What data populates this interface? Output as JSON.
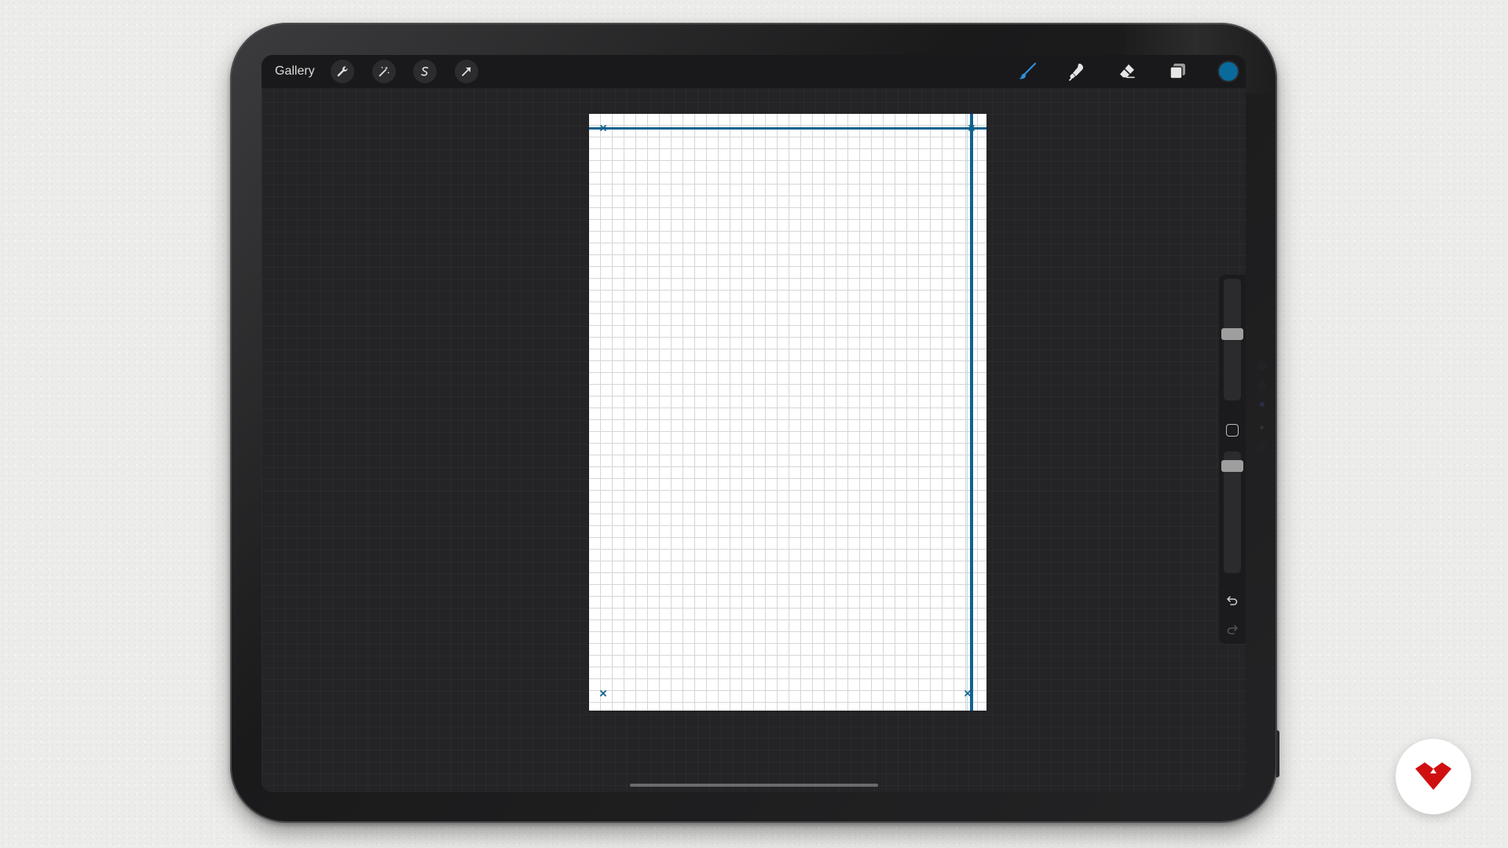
{
  "toolbar": {
    "gallery_label": "Gallery",
    "left_tools": [
      "wrench-icon",
      "magic-wand-icon",
      "selection-icon",
      "transform-arrow-icon"
    ],
    "right_tools": [
      "brush-icon",
      "smudge-icon",
      "eraser-icon",
      "layers-icon"
    ],
    "active_tool": "brush-icon",
    "active_color": "#0a6a9b"
  },
  "canvas": {
    "background": "#ffffff",
    "grid_color": "#d6d6d6",
    "guide_color": "#10628f"
  },
  "sidebar": {
    "brush_size_level": 0.55,
    "opacity_level": 0.92,
    "buttons": [
      "modify-button",
      "undo-icon",
      "redo-icon"
    ]
  },
  "colors": {
    "background": "#ececea",
    "device_frame": "#1e1e20",
    "workspace": "#242427",
    "brand_logo": "#d01010"
  }
}
